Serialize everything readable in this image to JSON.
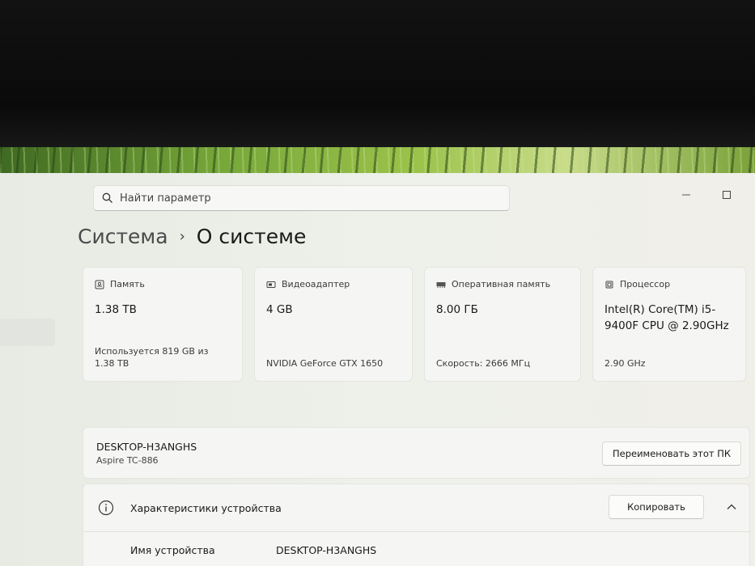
{
  "search": {
    "placeholder": "Найти параметр"
  },
  "breadcrumb": {
    "parent": "Система",
    "current": "О системе"
  },
  "cards": [
    {
      "icon": "storage-icon",
      "label": "Память",
      "value": "1.38 TB",
      "sub": "Используется 819 GB из 1.38 TB"
    },
    {
      "icon": "gpu-icon",
      "label": "Видеоадаптер",
      "value": "4 GB",
      "sub": "NVIDIA GeForce GTX 1650"
    },
    {
      "icon": "ram-icon",
      "label": "Оперативная память",
      "value": "8.00 ГБ",
      "sub": "Скорость: 2666 МГц"
    },
    {
      "icon": "cpu-icon",
      "label": "Процессор",
      "value": "Intel(R) Core(TM) i5-9400F CPU @ 2.90GHz",
      "sub": "2.90 GHz"
    }
  ],
  "device": {
    "name": "DESKTOP-H3ANGHS",
    "model": "Aspire TC-886",
    "rename_label": "Переименовать этот ПК"
  },
  "specs": {
    "title": "Характеристики устройства",
    "copy_label": "Копировать",
    "rows": [
      {
        "key": "Имя устройства",
        "value": "DESKTOP-H3ANGHS"
      }
    ]
  }
}
